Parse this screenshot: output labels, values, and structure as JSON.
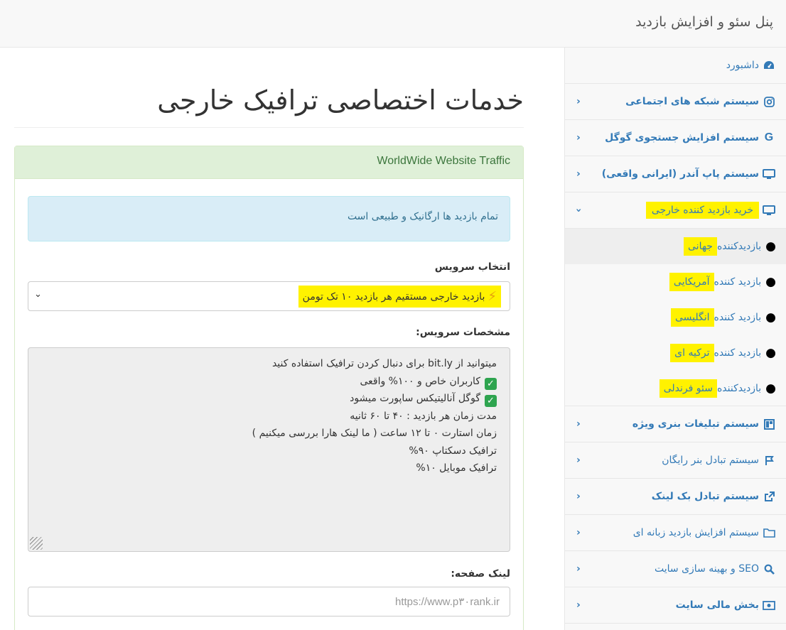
{
  "header": {
    "brand": "پنل سئو و افزایش بازدید"
  },
  "sidebar": {
    "items": [
      {
        "label": "داشبورد",
        "icon": "dashboard-icon"
      },
      {
        "label": "سیستم شبکه های اجتماعی",
        "icon": "instagram-icon"
      },
      {
        "label": "سیستم افزایش جستجوی گوگل",
        "icon": "google-icon"
      },
      {
        "label": "سیستم پاپ آندر (ایرانی واقعی)",
        "icon": "desktop-icon"
      },
      {
        "label": "خرید بازدید کننده خارجی",
        "icon": "desktop-icon"
      },
      {
        "label": "سیستم تبلیغات بنری ویژه",
        "icon": "banner-icon"
      },
      {
        "label": "سیستم تبادل بنر رایگان",
        "icon": "flag-icon"
      },
      {
        "label": "سیستم تبادل بک لینک",
        "icon": "external-link-icon"
      },
      {
        "label": "سیستم افزایش بازدید زبانه ای",
        "icon": "folder-icon"
      },
      {
        "label": "SEO و بهینه سازی سایت",
        "icon": "search-icon"
      },
      {
        "label": "بخش مالی سایت",
        "icon": "money-icon"
      }
    ],
    "submenu": [
      {
        "prefix": "بازدیدکننده",
        "highlight": "جهانی"
      },
      {
        "prefix": "بازدید کننده",
        "highlight": "آمریکایی"
      },
      {
        "prefix": "بازدید کننده",
        "highlight": "انگلیسی"
      },
      {
        "prefix": "بازدید کننده",
        "highlight": "ترکیه ای"
      },
      {
        "prefix": "بازدیدکننده",
        "highlight": "سئو فرندلی"
      }
    ]
  },
  "main": {
    "title": "خدمات اختصاصی ترافیک خارجی",
    "panel_heading": "WorldWide Website Traffic",
    "alert": "تمام بازدید ها ارگانیک و طبیعی است",
    "service_label": "انتخاب سرویس",
    "service_value": "بازدید خارجی مستقیم هر بازدید ۱۰ تک تومن",
    "details_label": "مشخصات سرویس:",
    "details_lines": [
      "میتوانید از bit.ly برای دنبال کردن ترافیک استفاده کنید",
      "کاربران خاص و ۱۰۰% واقعی",
      "گوگل آنالیتیکس ساپورت میشود",
      "مدت زمان هر بازدید : ۴۰ تا ۶۰ ثانیه",
      "زمان استارت ۰ تا ۱۲ ساعت ( ما لینک هارا بررسی میکنیم )",
      "ترافیک دسکتاپ ۹۰%",
      "ترافیک موبایل ۱۰%"
    ],
    "link_label": "لینک صفحه:",
    "link_placeholder": "https://www.p۳۰rank.ir"
  }
}
